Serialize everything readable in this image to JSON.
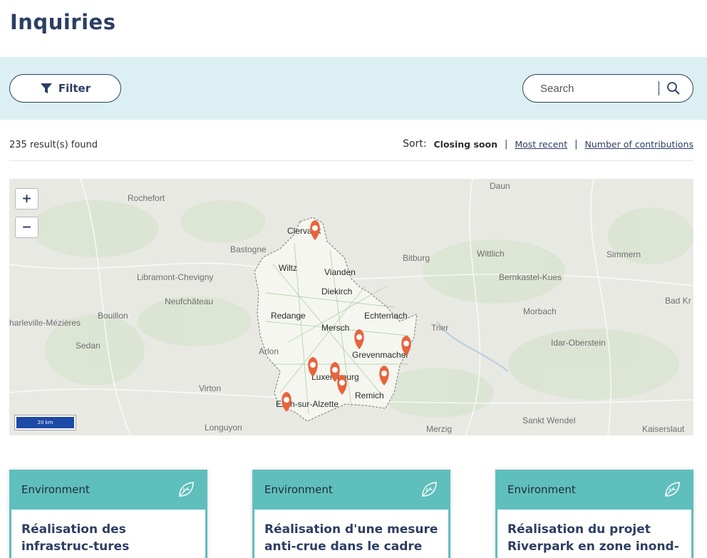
{
  "page": {
    "title": "Inquiries"
  },
  "filter": {
    "label": "Filter"
  },
  "search": {
    "placeholder": "Search"
  },
  "results": {
    "count_text": "235 result(s) found",
    "sort_label": "Sort:",
    "sort_active": "Closing soon",
    "sort_options": [
      "Most recent",
      "Number of contributions"
    ],
    "separator": "|"
  },
  "map": {
    "zoom_in": "+",
    "zoom_out": "−",
    "scale_label": "20 km",
    "places": [
      {
        "label": "Rochefort"
      },
      {
        "label": "Daun"
      },
      {
        "label": "Bastogne"
      },
      {
        "label": "Clervaux"
      },
      {
        "label": "Bitburg"
      },
      {
        "label": "Wittlich"
      },
      {
        "label": "Simmern"
      },
      {
        "label": "Libramont-Chevigny"
      },
      {
        "label": "Wiltz"
      },
      {
        "label": "Vianden"
      },
      {
        "label": "Bernkastel-Kues"
      },
      {
        "label": "Diekirch"
      },
      {
        "label": "Neufchâteau"
      },
      {
        "label": "Bad Kr"
      },
      {
        "label": "Bouillon"
      },
      {
        "label": "Redange"
      },
      {
        "label": "Echternach"
      },
      {
        "label": "Morbach"
      },
      {
        "label": "harleville-Mézières"
      },
      {
        "label": "Mersch"
      },
      {
        "label": "Trier"
      },
      {
        "label": "Sedan"
      },
      {
        "label": "Grevenmacher"
      },
      {
        "label": "Idar-Oberstein"
      },
      {
        "label": "Arlon"
      },
      {
        "label": "Luxembourg"
      },
      {
        "label": "Virton"
      },
      {
        "label": "Remich"
      },
      {
        "label": "Esch-sur-Alzette"
      },
      {
        "label": "Longuyon"
      },
      {
        "label": "Sankt Wendel"
      },
      {
        "label": "Merzig"
      },
      {
        "label": "Kaiserslaut"
      }
    ],
    "marker_color": "#e8643c"
  },
  "cards": [
    {
      "category": "Environment",
      "title": "Réalisation des infrastruc-tures d'assainissement dans"
    },
    {
      "category": "Environment",
      "title": "Réalisation d'une mesure anti-crue dans le cadre du"
    },
    {
      "category": "Environment",
      "title": "Réalisation du projet Riverpark en zone inond-"
    }
  ],
  "colors": {
    "accent": "#5fbfbd",
    "primary": "#2c3e63",
    "band": "#dcf0f3"
  }
}
